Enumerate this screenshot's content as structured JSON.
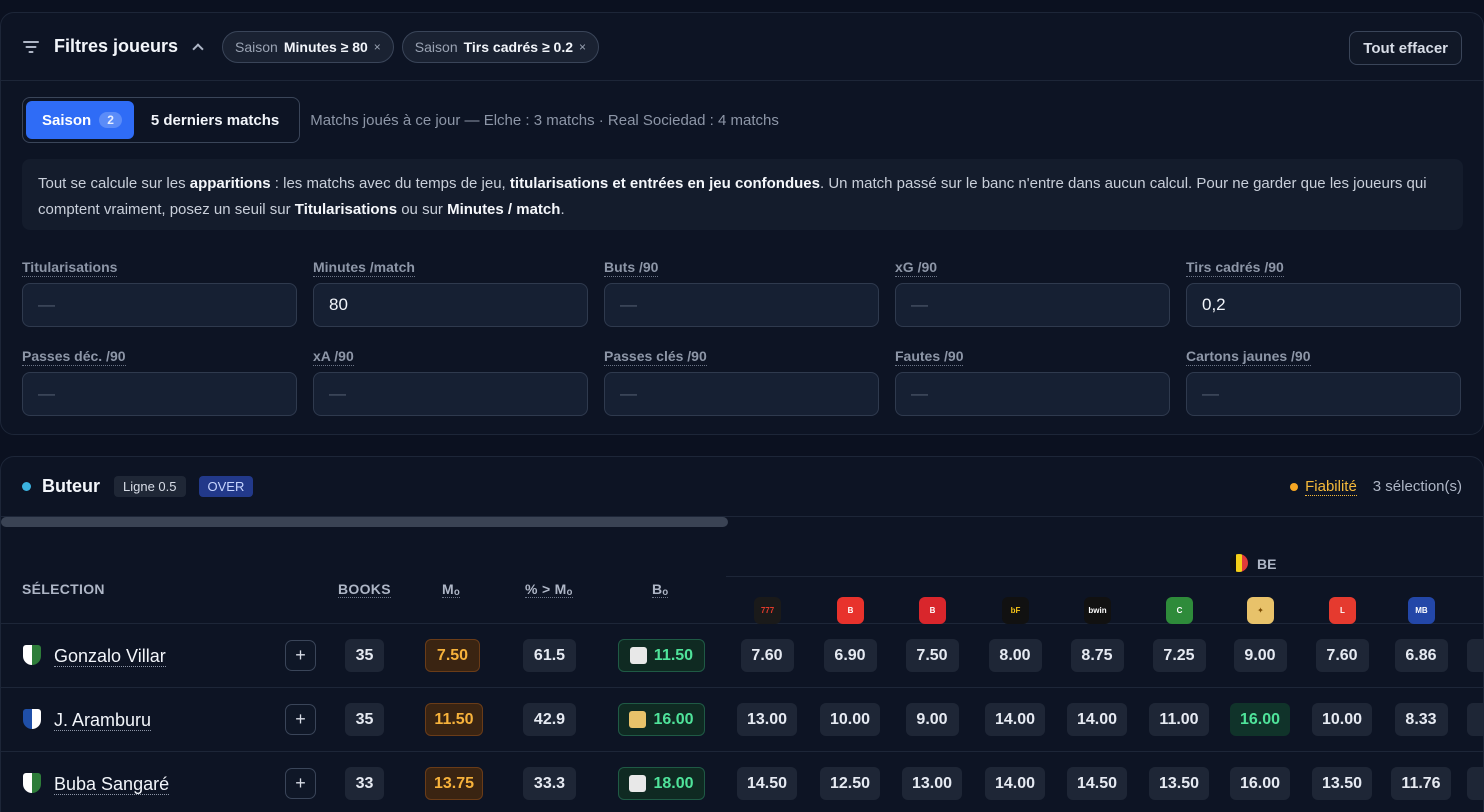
{
  "filters": {
    "title": "Filtres joueurs",
    "chips": [
      {
        "key": "Saison",
        "value": "Minutes ≥ 80",
        "x": "×"
      },
      {
        "key": "Saison",
        "value": "Tirs cadrés ≥ 0.2",
        "x": "×"
      }
    ],
    "clear_label": "Tout effacer",
    "tabs": {
      "season_label": "Saison",
      "season_count": "2",
      "last5_label": "5 derniers matchs"
    },
    "played_text": "Matchs joués à ce jour — Elche : 3 matchs · Real Sociedad : 4 matchs",
    "note": {
      "t1": "Tout se calcule sur les ",
      "b1": "apparitions",
      "t2": " : les matchs avec du temps de jeu, ",
      "b2": "titularisations et entrées en jeu confondues",
      "t3": ". Un match passé sur le banc n'entre dans aucun calcul. Pour ne garder que les joueurs qui comptent vraiment, posez un seuil sur ",
      "b3": "Titularisations",
      "t4": " ou sur ",
      "b4": "Minutes / match",
      "t5": "."
    },
    "fields": [
      {
        "label": "Titularisations",
        "value": "",
        "placeholder": "—"
      },
      {
        "label": "Minutes /match",
        "value": "80",
        "placeholder": "—"
      },
      {
        "label": "Buts /90",
        "value": "",
        "placeholder": "—"
      },
      {
        "label": "xG /90",
        "value": "",
        "placeholder": "—"
      },
      {
        "label": "Tirs cadrés /90",
        "value": "0,2",
        "placeholder": "—"
      },
      {
        "label": "Passes déc. /90",
        "value": "",
        "placeholder": "—"
      },
      {
        "label": "xA /90",
        "value": "",
        "placeholder": "—"
      },
      {
        "label": "Passes clés /90",
        "value": "",
        "placeholder": "—"
      },
      {
        "label": "Fautes /90",
        "value": "",
        "placeholder": "—"
      },
      {
        "label": "Cartons jaunes /90",
        "value": "",
        "placeholder": "—"
      }
    ]
  },
  "market": {
    "title": "Buteur",
    "line_tag": "Ligne 0.5",
    "over_tag": "OVER",
    "fiab_label": "Fiabilité",
    "selections": "3 sélection(s)",
    "columns": {
      "selection": "SÉLECTION",
      "books": "BOOKS",
      "mo": "Mₒ",
      "pct": "% > Mₒ",
      "bo": "Bₒ"
    },
    "region": "BE",
    "books": [
      {
        "name": "777-icon",
        "text": "777",
        "color": "#1a1a1a",
        "fg": "#e03a2b"
      },
      {
        "name": "betano-icon",
        "text": "B",
        "color": "#e8322c",
        "fg": "#ffffff"
      },
      {
        "name": "betfirst-icon",
        "text": "B",
        "color": "#d9262c",
        "fg": "#ffffff"
      },
      {
        "name": "betfirst-bf-icon",
        "text": "bF",
        "color": "#111111",
        "fg": "#f5c518"
      },
      {
        "name": "bwin-icon",
        "text": "bwin",
        "color": "#111111",
        "fg": "#ffffff"
      },
      {
        "name": "circus-icon",
        "text": "C",
        "color": "#2e8b3a",
        "fg": "#ffffff"
      },
      {
        "name": "golden-palace-icon",
        "text": "✦",
        "color": "#e8c26a",
        "fg": "#7a4a00"
      },
      {
        "name": "ladbrokes-icon",
        "text": "L",
        "color": "#e53a2f",
        "fg": "#ffffff"
      },
      {
        "name": "magicbetting-icon",
        "text": "MB",
        "color": "#2347a8",
        "fg": "#ffffff"
      }
    ],
    "rows": [
      {
        "name": "Gonzalo Villar",
        "club": "elche",
        "books": "35",
        "mo": "7.50",
        "pct": "61.5",
        "bo": "11.50",
        "bo_book": "scooore",
        "odds": [
          "7.60",
          "6.90",
          "7.50",
          "8.00",
          "8.75",
          "7.25",
          "9.00",
          "7.60",
          "6.86"
        ],
        "hl": -1
      },
      {
        "name": "J. Aramburu",
        "club": "real-sociedad",
        "books": "35",
        "mo": "11.50",
        "pct": "42.9",
        "bo": "16.00",
        "bo_book": "golden-palace",
        "odds": [
          "13.00",
          "10.00",
          "9.00",
          "14.00",
          "14.00",
          "11.00",
          "16.00",
          "10.00",
          "8.33"
        ],
        "hl": 6
      },
      {
        "name": "Buba Sangaré",
        "club": "elche",
        "books": "33",
        "mo": "13.75",
        "pct": "33.3",
        "bo": "18.00",
        "bo_book": "scooore",
        "odds": [
          "14.50",
          "12.50",
          "13.00",
          "14.00",
          "14.50",
          "13.50",
          "16.00",
          "13.50",
          "11.76"
        ],
        "hl": -1
      }
    ],
    "plus": "+"
  }
}
